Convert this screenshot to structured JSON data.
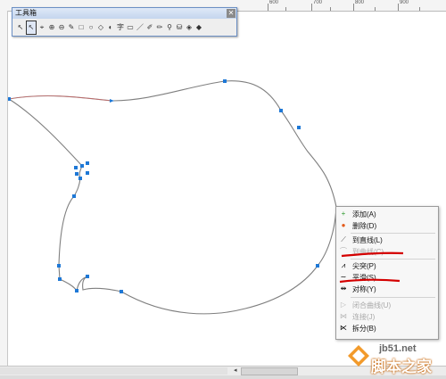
{
  "ruler": {
    "labels": [
      "600",
      "700",
      "800",
      "900"
    ]
  },
  "toolbox": {
    "title": "工具箱",
    "close_glyph": "✕",
    "tools": [
      {
        "name": "pointer-icon",
        "glyph": "↖"
      },
      {
        "name": "subselect-icon",
        "glyph": "↖",
        "selected": true
      },
      {
        "name": "lasso-icon",
        "glyph": "⌖"
      },
      {
        "name": "zoom-icon",
        "glyph": "⊕"
      },
      {
        "name": "zoom-out-icon",
        "glyph": "⊖"
      },
      {
        "name": "pen-icon",
        "glyph": "✎"
      },
      {
        "name": "rectangle-icon",
        "glyph": "□"
      },
      {
        "name": "ellipse-icon",
        "glyph": "○"
      },
      {
        "name": "polygon-icon",
        "glyph": "◇"
      },
      {
        "name": "gradient-icon",
        "glyph": "◐"
      },
      {
        "name": "text-icon",
        "glyph": "字"
      },
      {
        "name": "frame-icon",
        "glyph": "▭"
      },
      {
        "name": "line-icon",
        "glyph": "／"
      },
      {
        "name": "brush-icon",
        "glyph": "✐"
      },
      {
        "name": "pencil-icon",
        "glyph": "✏"
      },
      {
        "name": "eyedropper-icon",
        "glyph": "⚲"
      },
      {
        "name": "paint-bucket-icon",
        "glyph": "⛁"
      },
      {
        "name": "eraser-icon",
        "glyph": "◈"
      },
      {
        "name": "fill-icon",
        "glyph": "◆"
      }
    ]
  },
  "context_menu": {
    "items": [
      {
        "name": "menu-add",
        "label": "添加(A)",
        "icon": "+",
        "icon_color": "#2e9a2e",
        "disabled": false
      },
      {
        "name": "menu-delete",
        "label": "删除(D)",
        "icon": "●",
        "icon_color": "#e35b1b",
        "disabled": false
      },
      {
        "name": "menu-to-line",
        "label": "到直线(L)",
        "icon": "⟋",
        "icon_color": "#555555",
        "disabled": false
      },
      {
        "name": "menu-to-curve",
        "label": "到曲线(C)",
        "icon": "⌒",
        "icon_color": "#b8b8b8",
        "disabled": true
      },
      {
        "name": "menu-cusp",
        "label": "尖突(P)",
        "icon": "⩘",
        "icon_color": "#333333",
        "disabled": false
      },
      {
        "name": "menu-smooth",
        "label": "平滑(S)",
        "icon": "∼",
        "icon_color": "#333333",
        "disabled": false
      },
      {
        "name": "menu-symmetric",
        "label": "对称(Y)",
        "icon": "⇹",
        "icon_color": "#333333",
        "disabled": false
      },
      {
        "name": "menu-close-curve",
        "label": "闭合曲线(U)",
        "icon": "▷",
        "icon_color": "#b8b8b8",
        "disabled": true
      },
      {
        "name": "menu-join",
        "label": "连接(J)",
        "icon": "⋈",
        "icon_color": "#b8b8b8",
        "disabled": true
      },
      {
        "name": "menu-split",
        "label": "拆分(B)",
        "icon": "⋉",
        "icon_color": "#333333",
        "disabled": false
      }
    ]
  },
  "annotation_color": "#d40000",
  "path_color": "#7f7f7f",
  "node_color": "#1e78d6",
  "watermark": {
    "site": "jb51.net",
    "text": "脚本之家"
  }
}
